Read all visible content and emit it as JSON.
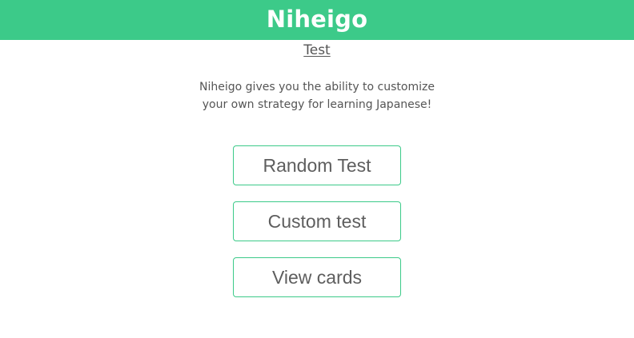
{
  "header": {
    "brand": "Niheigo"
  },
  "main": {
    "page_link": "Test",
    "description": "Niheigo gives you the ability to customize your own strategy for learning Japanese!",
    "buttons": [
      {
        "label": "Random Test"
      },
      {
        "label": "Custom test"
      },
      {
        "label": "View cards"
      }
    ]
  },
  "colors": {
    "brand": "#3cca89",
    "text": "#555555",
    "background": "#ffffff"
  }
}
